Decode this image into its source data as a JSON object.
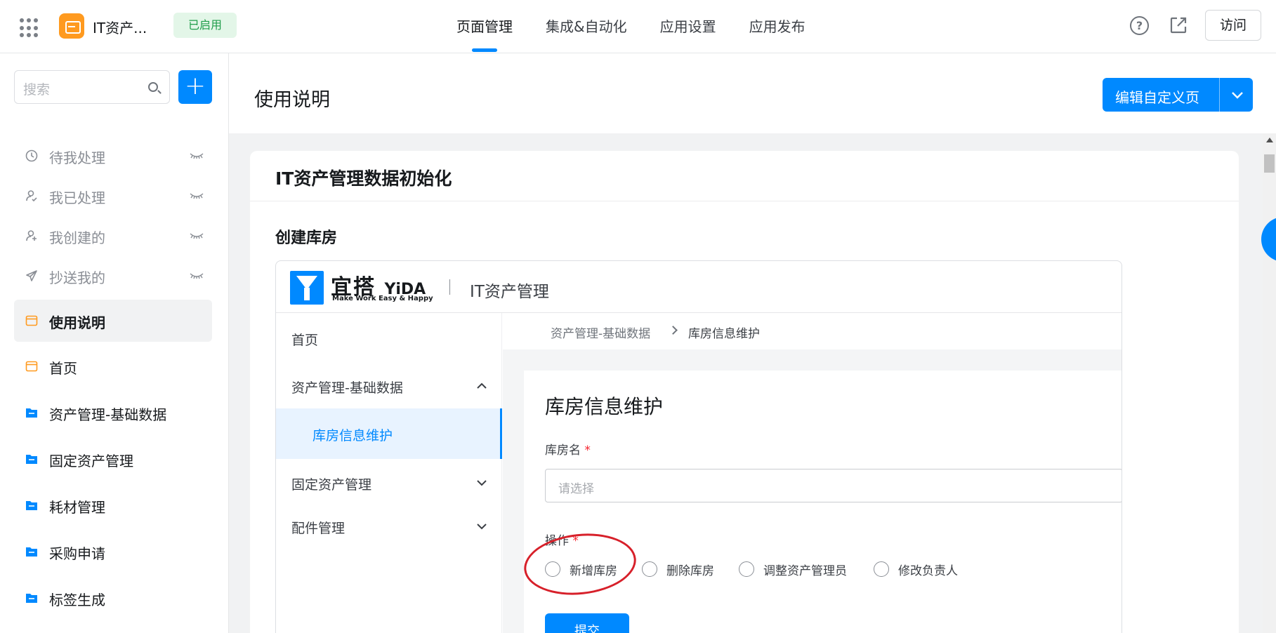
{
  "topbar": {
    "app_name": "IT资产...",
    "status_badge": "已启用",
    "nav": [
      "页面管理",
      "集成&自动化",
      "应用设置",
      "应用发布"
    ],
    "active_nav": "页面管理",
    "visit_label": "访问"
  },
  "sidebar": {
    "search_placeholder": "搜索",
    "items": [
      {
        "label": "待我处理",
        "icon": "clock-icon",
        "muted": true
      },
      {
        "label": "我已处理",
        "icon": "user-check-icon",
        "muted": true
      },
      {
        "label": "我创建的",
        "icon": "user-plus-icon",
        "muted": true
      },
      {
        "label": "抄送我的",
        "icon": "send-icon",
        "muted": true
      },
      {
        "label": "使用说明",
        "icon": "page-icon",
        "active": true
      },
      {
        "label": "首页",
        "icon": "page-icon"
      },
      {
        "label": "资产管理-基础数据",
        "icon": "folder-icon"
      },
      {
        "label": "固定资产管理",
        "icon": "folder-icon"
      },
      {
        "label": "耗材管理",
        "icon": "folder-icon"
      },
      {
        "label": "采购申请",
        "icon": "folder-icon"
      },
      {
        "label": "标签生成",
        "icon": "folder-icon"
      }
    ]
  },
  "main": {
    "page_title": "使用说明",
    "edit_button": "编辑自定义页",
    "card_title": "IT资产管理数据初始化",
    "section_title": "创建库房"
  },
  "embedded": {
    "brand_cn": "宜搭",
    "brand_en": "YiDA",
    "slogan": "Make Work Easy & Happy",
    "app_name": "IT资产管理",
    "nav": [
      {
        "label": "首页"
      },
      {
        "label": "资产管理-基础数据",
        "expanded": true
      },
      {
        "label": "库房信息维护",
        "child": true,
        "active": true
      },
      {
        "label": "固定资产管理"
      },
      {
        "label": "配件管理"
      }
    ],
    "breadcrumb": [
      "资产管理-基础数据",
      "库房信息维护"
    ],
    "form_title": "库房信息维护",
    "field_name_label": "库房名",
    "field_name_placeholder": "请选择",
    "field_op_label": "操作",
    "required_mark": "*",
    "radio_options": [
      "新增库房",
      "删除库房",
      "调整资产管理员",
      "修改负责人"
    ],
    "submit_label": "提交"
  },
  "colors": {
    "accent": "#0089ff",
    "logo": "#ff9a1f",
    "badge_bg": "#e3f6e8",
    "badge_text": "#1f9d4a",
    "highlight": "#d7202a"
  }
}
